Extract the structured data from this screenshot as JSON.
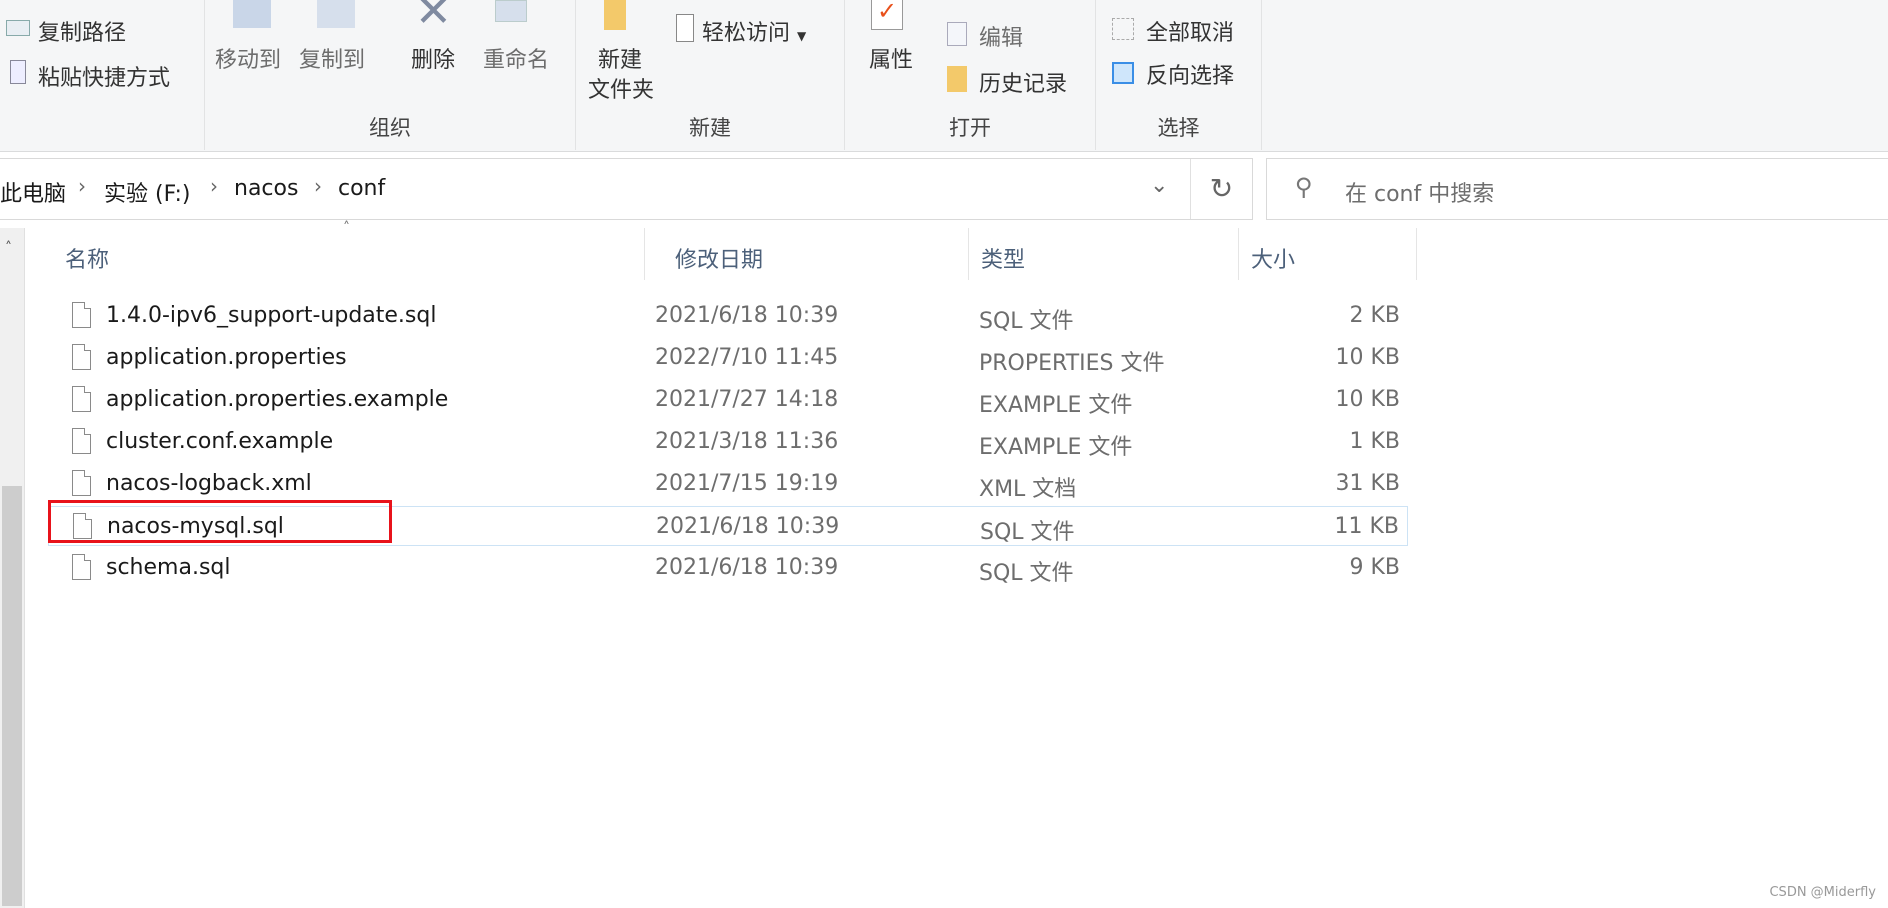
{
  "ribbon": {
    "clipboard": {
      "copy_path": "复制路径",
      "paste_shortcut": "粘贴快捷方式"
    },
    "organize": {
      "label": "组织",
      "move_to": "移动到",
      "copy_to": "复制到",
      "delete": "删除",
      "rename": "重命名"
    },
    "new": {
      "label": "新建",
      "new_folder_line1": "新建",
      "new_folder_line2": "文件夹",
      "easy_access": "轻松访问"
    },
    "open": {
      "label": "打开",
      "properties": "属性",
      "edit": "编辑",
      "history": "历史记录"
    },
    "select": {
      "label": "选择",
      "select_none": "全部取消",
      "invert_selection": "反向选择"
    }
  },
  "address": {
    "crumbs": [
      "此电脑",
      "实验 (F:)",
      "nacos",
      "conf"
    ]
  },
  "search": {
    "placeholder": "在 conf 中搜索"
  },
  "columns": {
    "name": "名称",
    "date": "修改日期",
    "type": "类型",
    "size": "大小"
  },
  "files": [
    {
      "name": "1.4.0-ipv6_support-update.sql",
      "date": "2021/6/18 10:39",
      "type": "SQL 文件",
      "size": "2 KB"
    },
    {
      "name": "application.properties",
      "date": "2022/7/10 11:45",
      "type": "PROPERTIES 文件",
      "size": "10 KB"
    },
    {
      "name": "application.properties.example",
      "date": "2021/7/27 14:18",
      "type": "EXAMPLE 文件",
      "size": "10 KB"
    },
    {
      "name": "cluster.conf.example",
      "date": "2021/3/18 11:36",
      "type": "EXAMPLE 文件",
      "size": "1 KB"
    },
    {
      "name": "nacos-logback.xml",
      "date": "2021/7/15 19:19",
      "type": "XML 文档",
      "size": "31 KB"
    },
    {
      "name": "nacos-mysql.sql",
      "date": "2021/6/18 10:39",
      "type": "SQL 文件",
      "size": "11 KB",
      "highlighted": true
    },
    {
      "name": "schema.sql",
      "date": "2021/6/18 10:39",
      "type": "SQL 文件",
      "size": "9 KB"
    }
  ],
  "highlight_color": "#e8131b",
  "watermark": "CSDN @Miderfly"
}
